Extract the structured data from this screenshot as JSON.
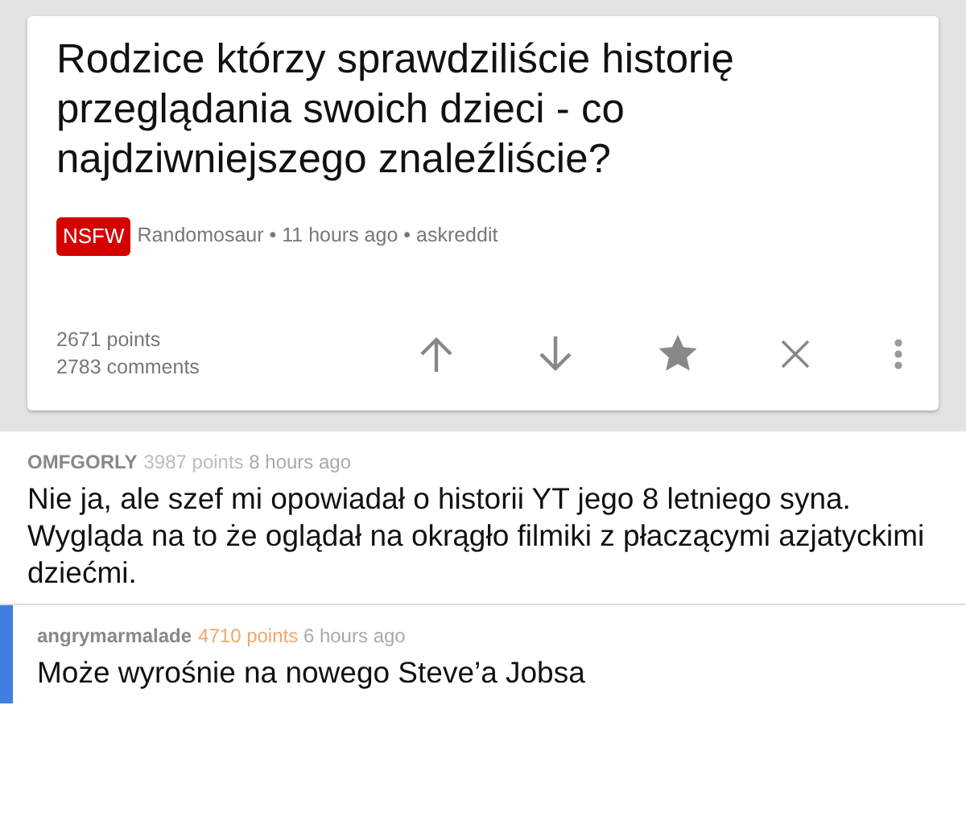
{
  "post": {
    "title": "Rodzice którzy sprawdziliście historię przeglądania swoich dzieci - co najdziwniejszego znaleźliście?",
    "nsfw": true,
    "nsfw_label": "NSFW",
    "meta": "Randomosaur • 11 hours ago • askreddit",
    "points": "2671 points",
    "comments": "2783 comments"
  },
  "comments": [
    {
      "author": "OMFGORLY",
      "points": "3987 points",
      "color": "#bdbdbd",
      "time": "8 hours ago",
      "text": "Nie ja, ale szef mi opowiadał o historii YT jego 8 letniego syna. Wygląda na to że oglądał na okrągło filmiki z płaczącymi azjatyckimi dziećmi.",
      "children": [
        {
          "author": "angrymarmalade",
          "points": "4710 points",
          "color": "#f0a868",
          "time": "6 hours ago",
          "text": "Może wyrośnie na nowego Steve’a Jobsa"
        }
      ]
    }
  ]
}
